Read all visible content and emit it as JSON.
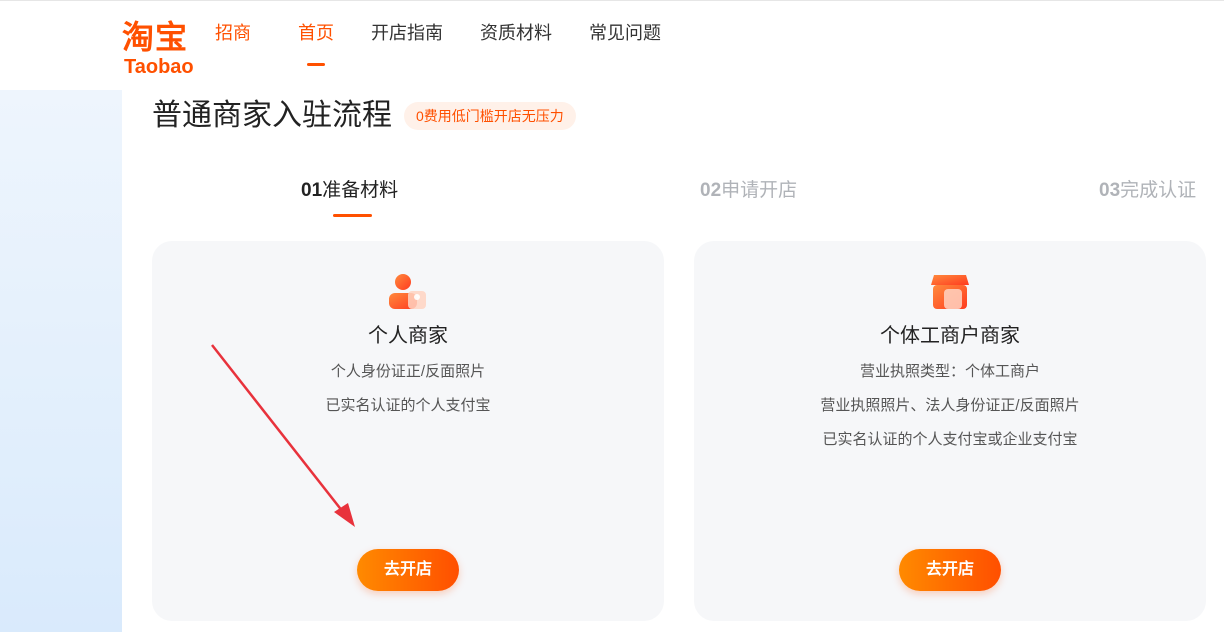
{
  "header": {
    "logo_cn": "淘宝",
    "logo_en": "Taobao",
    "logo_sub": "招商",
    "nav": [
      {
        "label": "首页",
        "active": true
      },
      {
        "label": "开店指南",
        "active": false
      },
      {
        "label": "资质材料",
        "active": false
      },
      {
        "label": "常见问题",
        "active": false
      }
    ]
  },
  "main": {
    "title": "普通商家入驻流程",
    "badge": "0费用低门槛开店无压力",
    "steps": [
      {
        "num": "01",
        "label": "准备材料",
        "active": true
      },
      {
        "num": "02",
        "label": "申请开店",
        "active": false
      },
      {
        "num": "03",
        "label": "完成认证",
        "active": false
      }
    ],
    "cards": [
      {
        "title": "个人商家",
        "lines": [
          "个人身份证正/反面照片",
          "已实名认证的个人支付宝"
        ],
        "button": "去开店",
        "icon": "person-icon"
      },
      {
        "title": "个体工商户商家",
        "lines": [
          "营业执照类型：个体工商户",
          "营业执照照片、法人身份证正/反面照片",
          "已实名认证的个人支付宝或企业支付宝"
        ],
        "button": "去开店",
        "icon": "shop-icon"
      }
    ]
  },
  "colors": {
    "brand": "#ff5000",
    "annotation_arrow": "#e8323c"
  }
}
